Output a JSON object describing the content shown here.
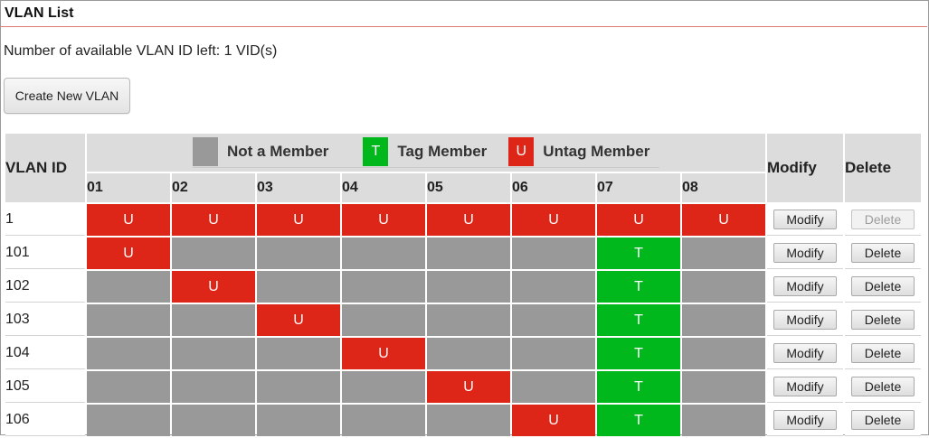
{
  "page": {
    "title": "VLAN List",
    "info_text": "Number of available VLAN ID left: 1 VID(s)",
    "create_button_label": "Create New VLAN"
  },
  "legend": {
    "not_member": {
      "label": "Not a Member",
      "symbol": "",
      "color": "#999999"
    },
    "tag_member": {
      "label": "Tag Member",
      "symbol": "T",
      "color": "#00b81c"
    },
    "untag_member": {
      "label": "Untag Member",
      "symbol": "U",
      "color": "#dd2518"
    }
  },
  "table": {
    "headers": {
      "vlan_id": "VLAN ID",
      "modify": "Modify",
      "delete": "Delete"
    },
    "ports": [
      "01",
      "02",
      "03",
      "04",
      "05",
      "06",
      "07",
      "08"
    ],
    "rows": [
      {
        "vlan_id": "1",
        "ports": [
          "U",
          "U",
          "U",
          "U",
          "U",
          "U",
          "U",
          "U"
        ],
        "modify_label": "Modify",
        "delete_label": "Delete",
        "delete_enabled": false
      },
      {
        "vlan_id": "101",
        "ports": [
          "U",
          "",
          "",
          "",
          "",
          "",
          "T",
          ""
        ],
        "modify_label": "Modify",
        "delete_label": "Delete",
        "delete_enabled": true
      },
      {
        "vlan_id": "102",
        "ports": [
          "",
          "U",
          "",
          "",
          "",
          "",
          "T",
          ""
        ],
        "modify_label": "Modify",
        "delete_label": "Delete",
        "delete_enabled": true
      },
      {
        "vlan_id": "103",
        "ports": [
          "",
          "",
          "U",
          "",
          "",
          "",
          "T",
          ""
        ],
        "modify_label": "Modify",
        "delete_label": "Delete",
        "delete_enabled": true
      },
      {
        "vlan_id": "104",
        "ports": [
          "",
          "",
          "",
          "U",
          "",
          "",
          "T",
          ""
        ],
        "modify_label": "Modify",
        "delete_label": "Delete",
        "delete_enabled": true
      },
      {
        "vlan_id": "105",
        "ports": [
          "",
          "",
          "",
          "",
          "U",
          "",
          "T",
          ""
        ],
        "modify_label": "Modify",
        "delete_label": "Delete",
        "delete_enabled": true
      },
      {
        "vlan_id": "106",
        "ports": [
          "",
          "",
          "",
          "",
          "",
          "U",
          "T",
          ""
        ],
        "modify_label": "Modify",
        "delete_label": "Delete",
        "delete_enabled": true
      }
    ]
  }
}
